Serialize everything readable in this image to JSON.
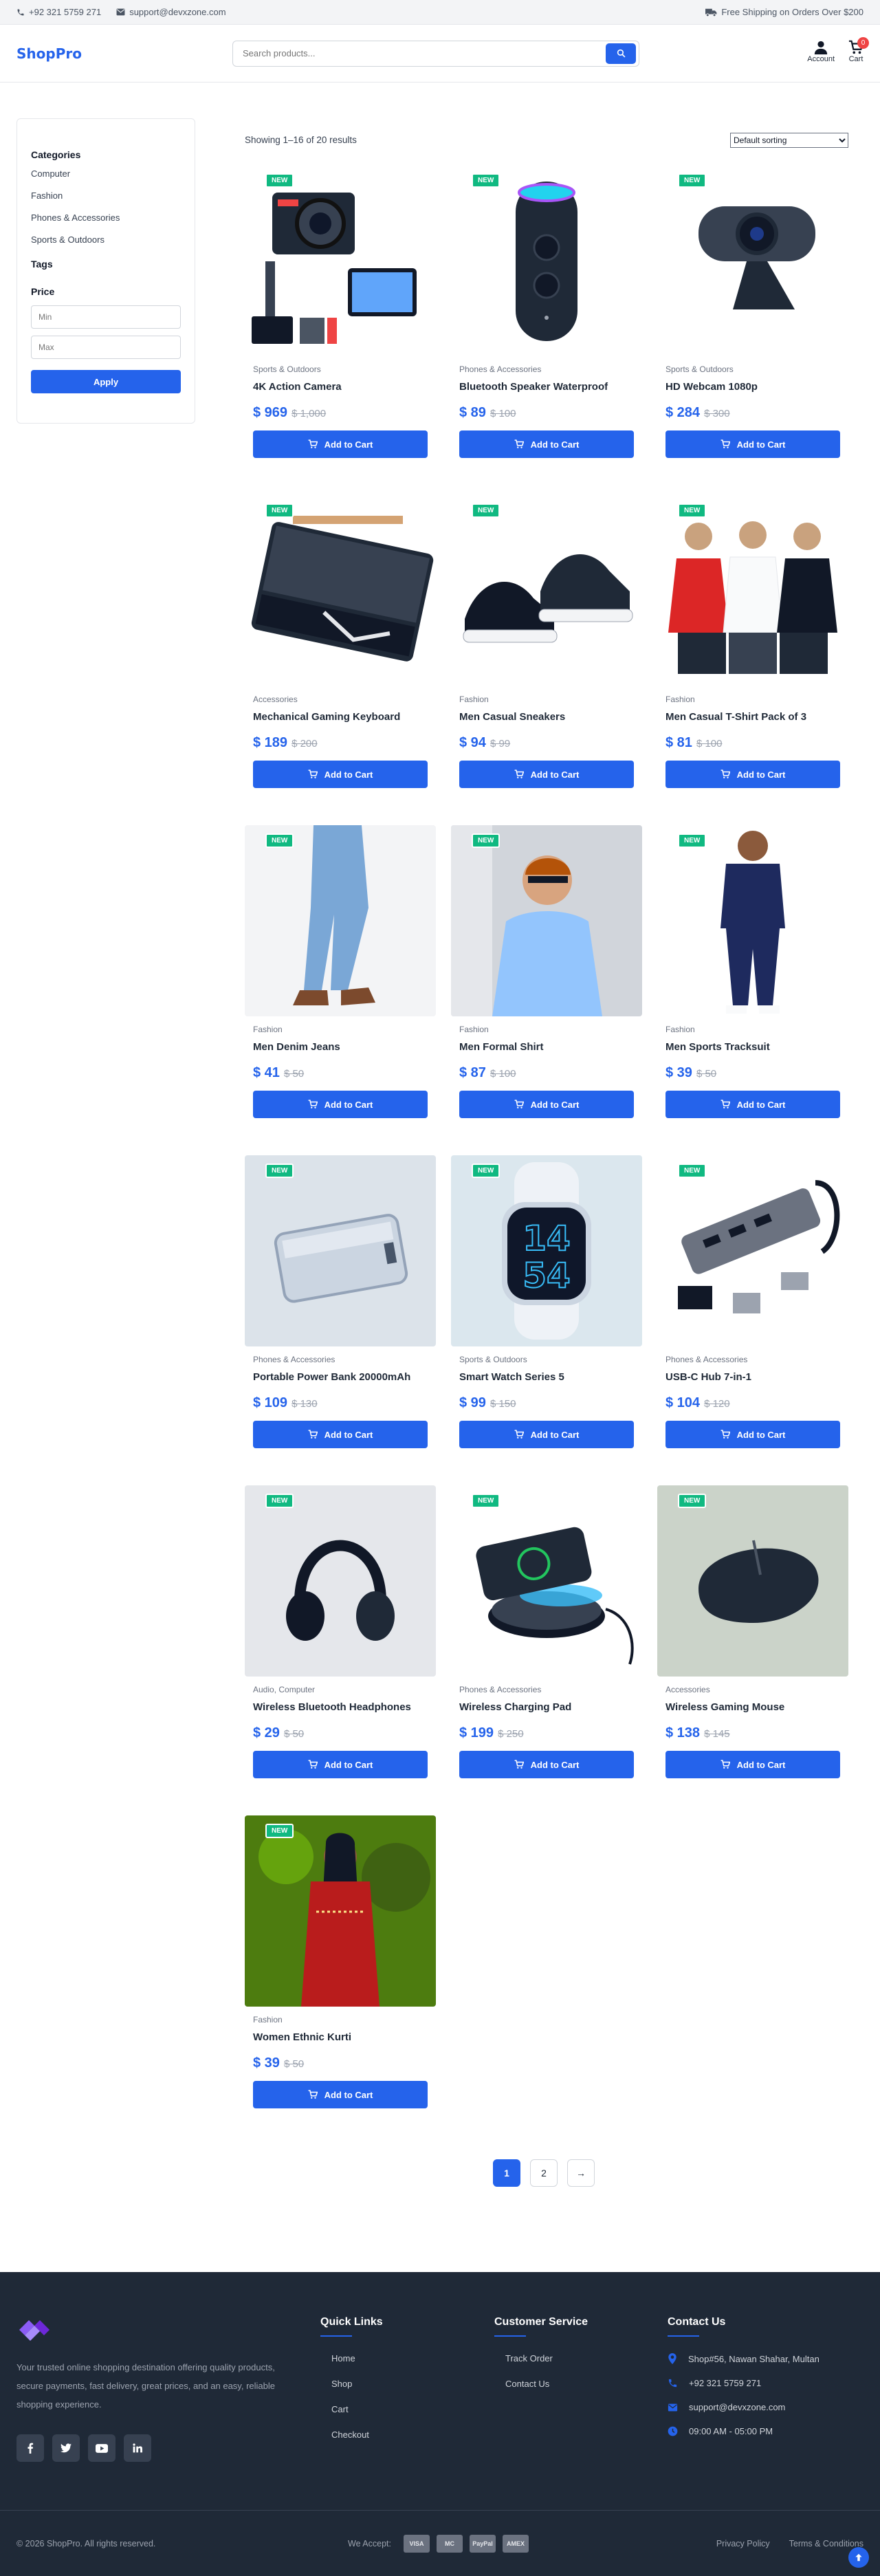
{
  "topbar": {
    "phone": "+92 321 5759 271",
    "email": "support@devxzone.com",
    "shipping": "Free Shipping on Orders Over $200"
  },
  "header": {
    "logo": "ShopPro",
    "search_placeholder": "Search products...",
    "account_label": "Account",
    "cart_label": "Cart",
    "cart_count": "0"
  },
  "sidebar": {
    "categories_title": "Categories",
    "categories": [
      "Computer",
      "Fashion",
      "Phones & Accessories",
      "Sports & Outdoors"
    ],
    "tags_title": "Tags",
    "price_title": "Price",
    "min_placeholder": "Min",
    "max_placeholder": "Max",
    "apply_label": "Apply"
  },
  "listing": {
    "results_text": "Showing 1–16 of 20 results",
    "sort_selected": "Default sorting",
    "new_badge": "NEW",
    "add_to_cart": "Add to Cart"
  },
  "products": [
    {
      "category": "Sports & Outdoors",
      "name": "4K Action Camera",
      "price": "$ 969",
      "old_price": "$ 1,000",
      "image": "action-camera"
    },
    {
      "category": "Phones & Accessories",
      "name": "Bluetooth Speaker Waterproof",
      "price": "$ 89",
      "old_price": "$ 100",
      "image": "speaker"
    },
    {
      "category": "Sports & Outdoors",
      "name": "HD Webcam 1080p",
      "price": "$ 284",
      "old_price": "$ 300",
      "image": "webcam"
    },
    {
      "category": "Accessories",
      "name": "Mechanical Gaming Keyboard",
      "price": "$ 189",
      "old_price": "$ 200",
      "image": "keyboard"
    },
    {
      "category": "Fashion",
      "name": "Men Casual Sneakers",
      "price": "$ 94",
      "old_price": "$ 99",
      "image": "sneakers"
    },
    {
      "category": "Fashion",
      "name": "Men Casual T-Shirt Pack of 3",
      "price": "$ 81",
      "old_price": "$ 100",
      "image": "tshirts"
    },
    {
      "category": "Fashion",
      "name": "Men Denim Jeans",
      "price": "$ 41",
      "old_price": "$ 50",
      "image": "jeans"
    },
    {
      "category": "Fashion",
      "name": "Men Formal Shirt",
      "price": "$ 87",
      "old_price": "$ 100",
      "image": "formal-shirt"
    },
    {
      "category": "Fashion",
      "name": "Men Sports Tracksuit",
      "price": "$ 39",
      "old_price": "$ 50",
      "image": "tracksuit"
    },
    {
      "category": "Phones & Accessories",
      "name": "Portable Power Bank 20000mAh",
      "price": "$ 109",
      "old_price": "$ 130",
      "image": "power-bank"
    },
    {
      "category": "Sports & Outdoors",
      "name": "Smart Watch Series 5",
      "price": "$ 99",
      "old_price": "$ 150",
      "image": "smart-watch",
      "watch_time": [
        "14",
        "54"
      ]
    },
    {
      "category": "Phones & Accessories",
      "name": "USB-C Hub 7-in-1",
      "price": "$ 104",
      "old_price": "$ 120",
      "image": "usb-hub"
    },
    {
      "category": "Audio, Computer",
      "name": "Wireless Bluetooth Headphones",
      "price": "$ 29",
      "old_price": "$ 50",
      "image": "headphones"
    },
    {
      "category": "Phones & Accessories",
      "name": "Wireless Charging Pad",
      "price": "$ 199",
      "old_price": "$ 250",
      "image": "charging-pad"
    },
    {
      "category": "Accessories",
      "name": "Wireless Gaming Mouse",
      "price": "$ 138",
      "old_price": "$ 145",
      "image": "mouse"
    },
    {
      "category": "Fashion",
      "name": "Women Ethnic Kurti",
      "price": "$ 39",
      "old_price": "$ 50",
      "image": "kurti"
    }
  ],
  "pagination": {
    "pages": [
      "1",
      "2"
    ],
    "next": "→",
    "active": "1"
  },
  "footer": {
    "description": "Your trusted online shopping destination offering quality products, secure payments, fast delivery, great prices, and an easy, reliable shopping experience.",
    "quick_links_title": "Quick Links",
    "quick_links": [
      "Home",
      "Shop",
      "Cart",
      "Checkout"
    ],
    "service_title": "Customer Service",
    "service_links": [
      "Track Order",
      "Contact Us"
    ],
    "contact_title": "Contact Us",
    "contact": {
      "address": "Shop#56, Nawan Shahar, Multan",
      "phone": "+92 321 5759 271",
      "email": "support@devxzone.com",
      "hours": "09:00 AM - 05:00 PM"
    },
    "copyright": "© 2026 ShopPro. All rights reserved.",
    "we_accept": "We Accept:",
    "payment_methods": [
      "VISA",
      "MC",
      "PayPal",
      "AMEX"
    ],
    "legal_links": [
      "Privacy Policy",
      "Terms & Conditions"
    ]
  },
  "colors": {
    "primary": "#2563eb",
    "new_badge": "#10b981",
    "footer_bg": "#1f2937",
    "cart_badge": "#ef4444"
  },
  "icons": [
    "phone-icon",
    "mail-icon",
    "truck-icon",
    "search-icon",
    "user-icon",
    "cart-icon",
    "facebook-icon",
    "twitter-icon",
    "youtube-icon",
    "linkedin-icon",
    "location-icon",
    "clock-icon",
    "arrow-up-icon"
  ]
}
